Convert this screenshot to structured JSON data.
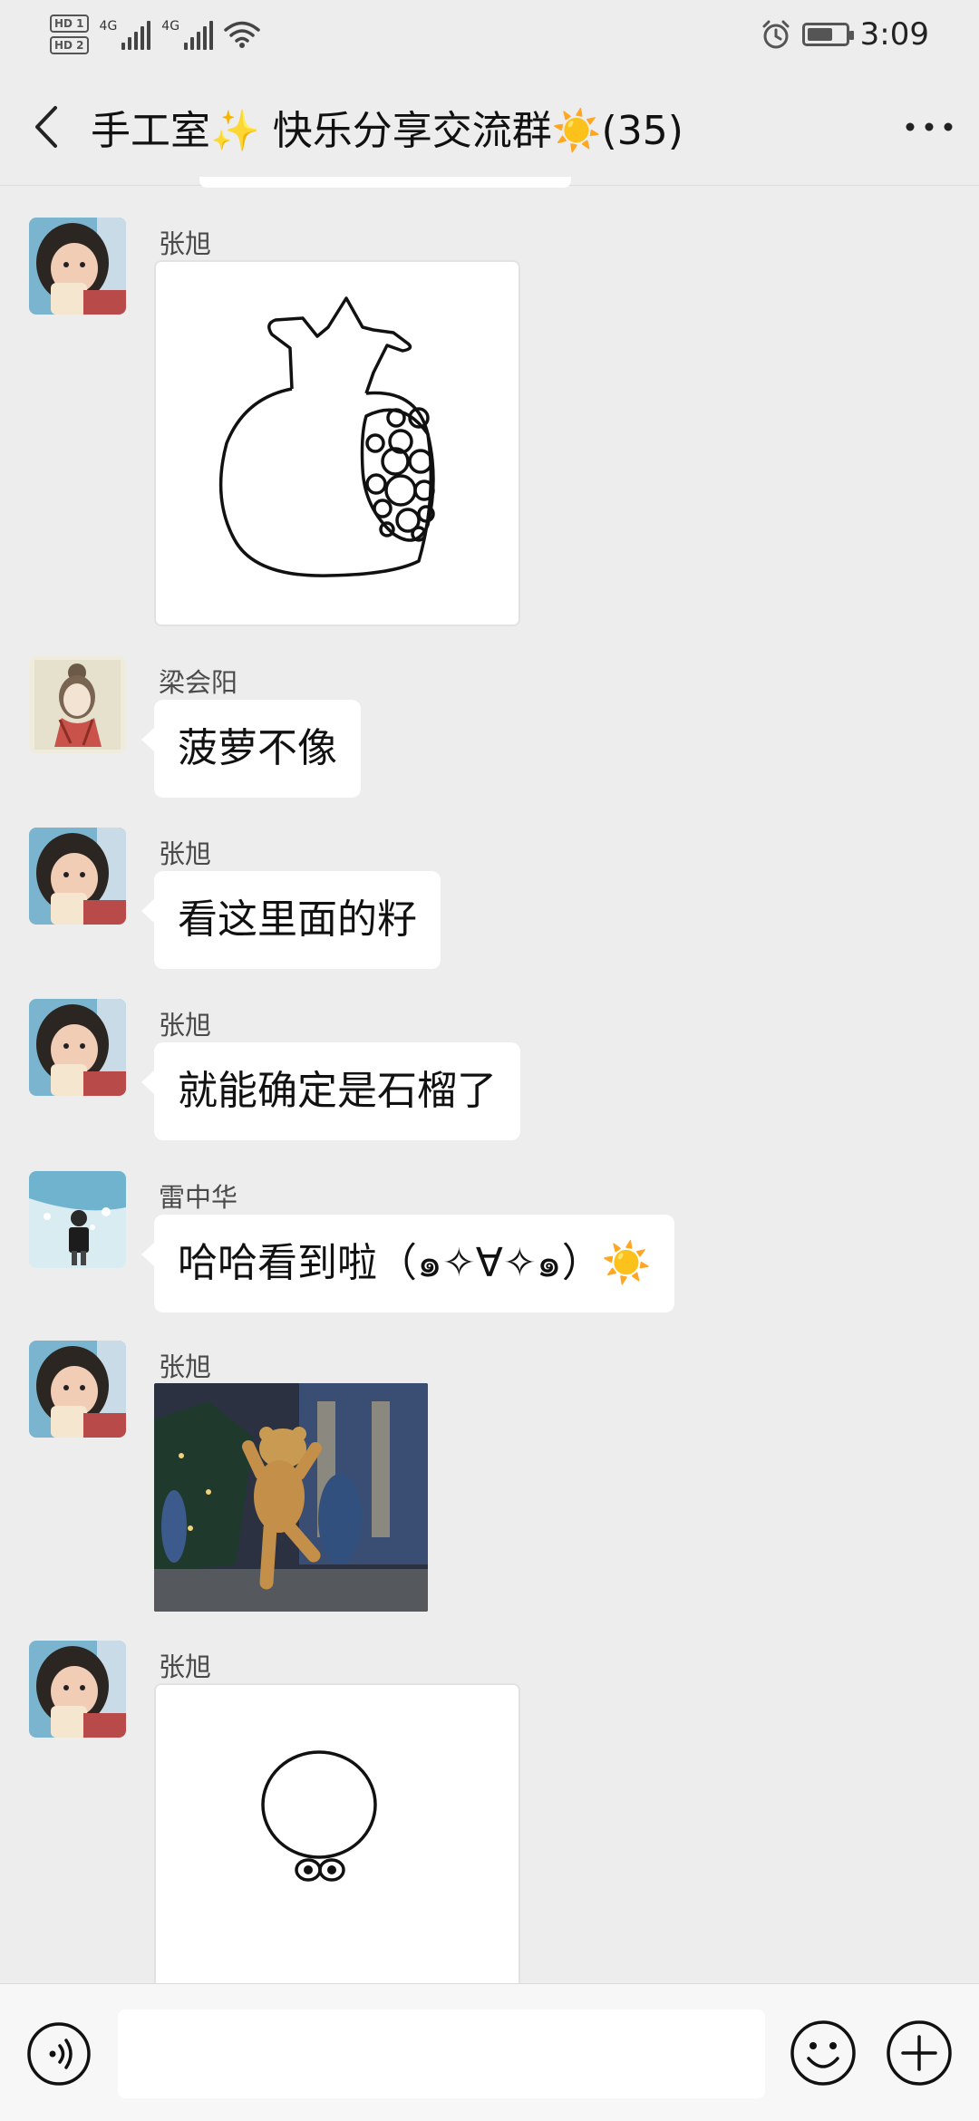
{
  "status": {
    "time": "3:09",
    "sim1": "HD 1",
    "sim2": "HD 2",
    "net1": "4G",
    "net2": "4G"
  },
  "header": {
    "title": "手工室✨ 快乐分享交流群☀️(35)"
  },
  "messages": [
    {
      "sender": "张旭",
      "type": "image",
      "image": "pomegranate-drawing"
    },
    {
      "sender": "梁会阳",
      "type": "text",
      "text": "菠萝不像"
    },
    {
      "sender": "张旭",
      "type": "text",
      "text": "看这里面的籽"
    },
    {
      "sender": "张旭",
      "type": "text",
      "text": "就能确定是石榴了"
    },
    {
      "sender": "雷中华",
      "type": "text",
      "text": "哈哈看到啦（๑✧∀✧๑）☀️"
    },
    {
      "sender": "张旭",
      "type": "image",
      "image": "dancing-bear-gif"
    },
    {
      "sender": "张旭",
      "type": "image",
      "image": "circle-drawing"
    }
  ],
  "input": {
    "placeholder": ""
  },
  "icons": {
    "back": "back-arrow-icon",
    "more": "more-dots-icon",
    "voice": "voice-icon",
    "emoji": "emoji-icon",
    "plus": "plus-icon"
  },
  "colors": {
    "background": "#ededed",
    "bubble": "#ffffff",
    "input_bar": "#f7f7f7"
  }
}
